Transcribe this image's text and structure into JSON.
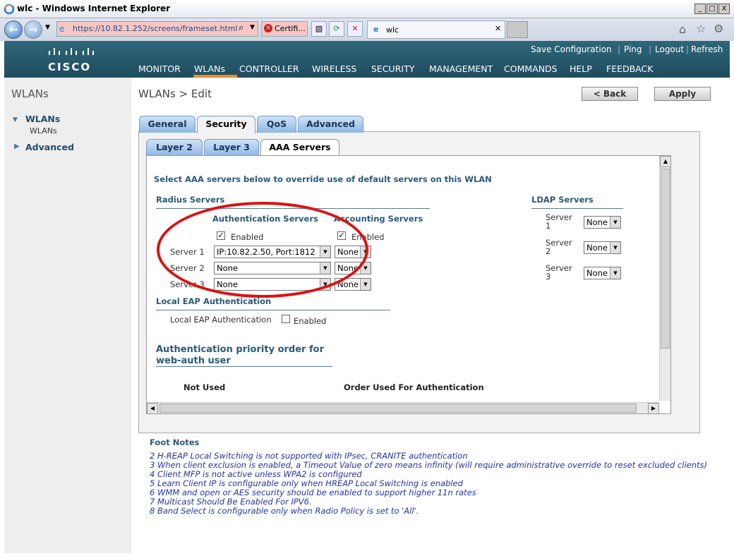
{
  "window": {
    "title": "wlc - Windows Internet Explorer",
    "min": "_",
    "max": "□",
    "close": "X"
  },
  "browser": {
    "address": "https://10.82.1.252/screens/frameset.html",
    "cert_label": "Certifi...",
    "tab_title": "wlc"
  },
  "brand": {
    "logo_text": "CISCO"
  },
  "toplinks": [
    "Save Configuration",
    "Ping",
    "Logout",
    "Refresh"
  ],
  "topnav": [
    "MONITOR",
    "WLANs",
    "CONTROLLER",
    "WIRELESS",
    "SECURITY",
    "MANAGEMENT",
    "COMMANDS",
    "HELP",
    "FEEDBACK"
  ],
  "sidebar": {
    "title": "WLANs",
    "items": [
      {
        "label": "WLANs",
        "sub": "WLANs"
      },
      {
        "label": "Advanced"
      }
    ]
  },
  "page": {
    "title": "WLANs > Edit",
    "back": "< Back",
    "apply": "Apply"
  },
  "tabs": [
    "General",
    "Security",
    "QoS",
    "Advanced"
  ],
  "subtabs": [
    "Layer 2",
    "Layer 3",
    "AAA Servers"
  ],
  "aaa": {
    "intro": "Select AAA servers below to override use of default servers on this WLAN",
    "radius_title": "Radius Servers",
    "auth_title": "Authentication Servers",
    "acct_title": "Accounting Servers",
    "enabled": "Enabled",
    "rows": [
      {
        "label": "Server 1",
        "auth": "IP:10.82.2.50, Port:1812",
        "acct": "None"
      },
      {
        "label": "Server 2",
        "auth": "None",
        "acct": "None"
      },
      {
        "label": "Server 3",
        "auth": "None",
        "acct": "None"
      }
    ],
    "ldap_title": "LDAP Servers",
    "ldap": [
      {
        "label1": "Server",
        "label2": "1",
        "value": "None"
      },
      {
        "label1": "Server",
        "label2": "2",
        "value": "None"
      },
      {
        "label1": "Server",
        "label2": "3",
        "value": "None"
      }
    ],
    "local_eap_title": "Local EAP Authentication",
    "local_eap_label": "Local EAP Authentication",
    "priority_title_1": "Authentication priority order for",
    "priority_title_2": "web-auth user",
    "not_used": "Not Used",
    "order_used": "Order Used For Authentication"
  },
  "footnotes": {
    "title": "Foot Notes",
    "lines": [
      "2 H-REAP Local Switching is not supported with IPsec, CRANITE authentication",
      "3 When client exclusion is enabled, a Timeout Value of zero means infinity (will require administrative override to reset excluded clients)",
      "4 Client MFP is not active unless WPA2 is configured",
      "5 Learn Client IP is configurable only when HREAP Local Switching is enabled",
      "6 WMM and open or AES security should be enabled to support higher 11n rates",
      "7 Multicast Should Be Enabled For IPV6.",
      "8 Band Select is configurable only when Radio Policy is set to 'All'."
    ]
  },
  "colors": {
    "header": "#2f6679",
    "active_underline": "#f08a2a",
    "annotation": "#dd1111",
    "footnote": "#2233aa"
  }
}
